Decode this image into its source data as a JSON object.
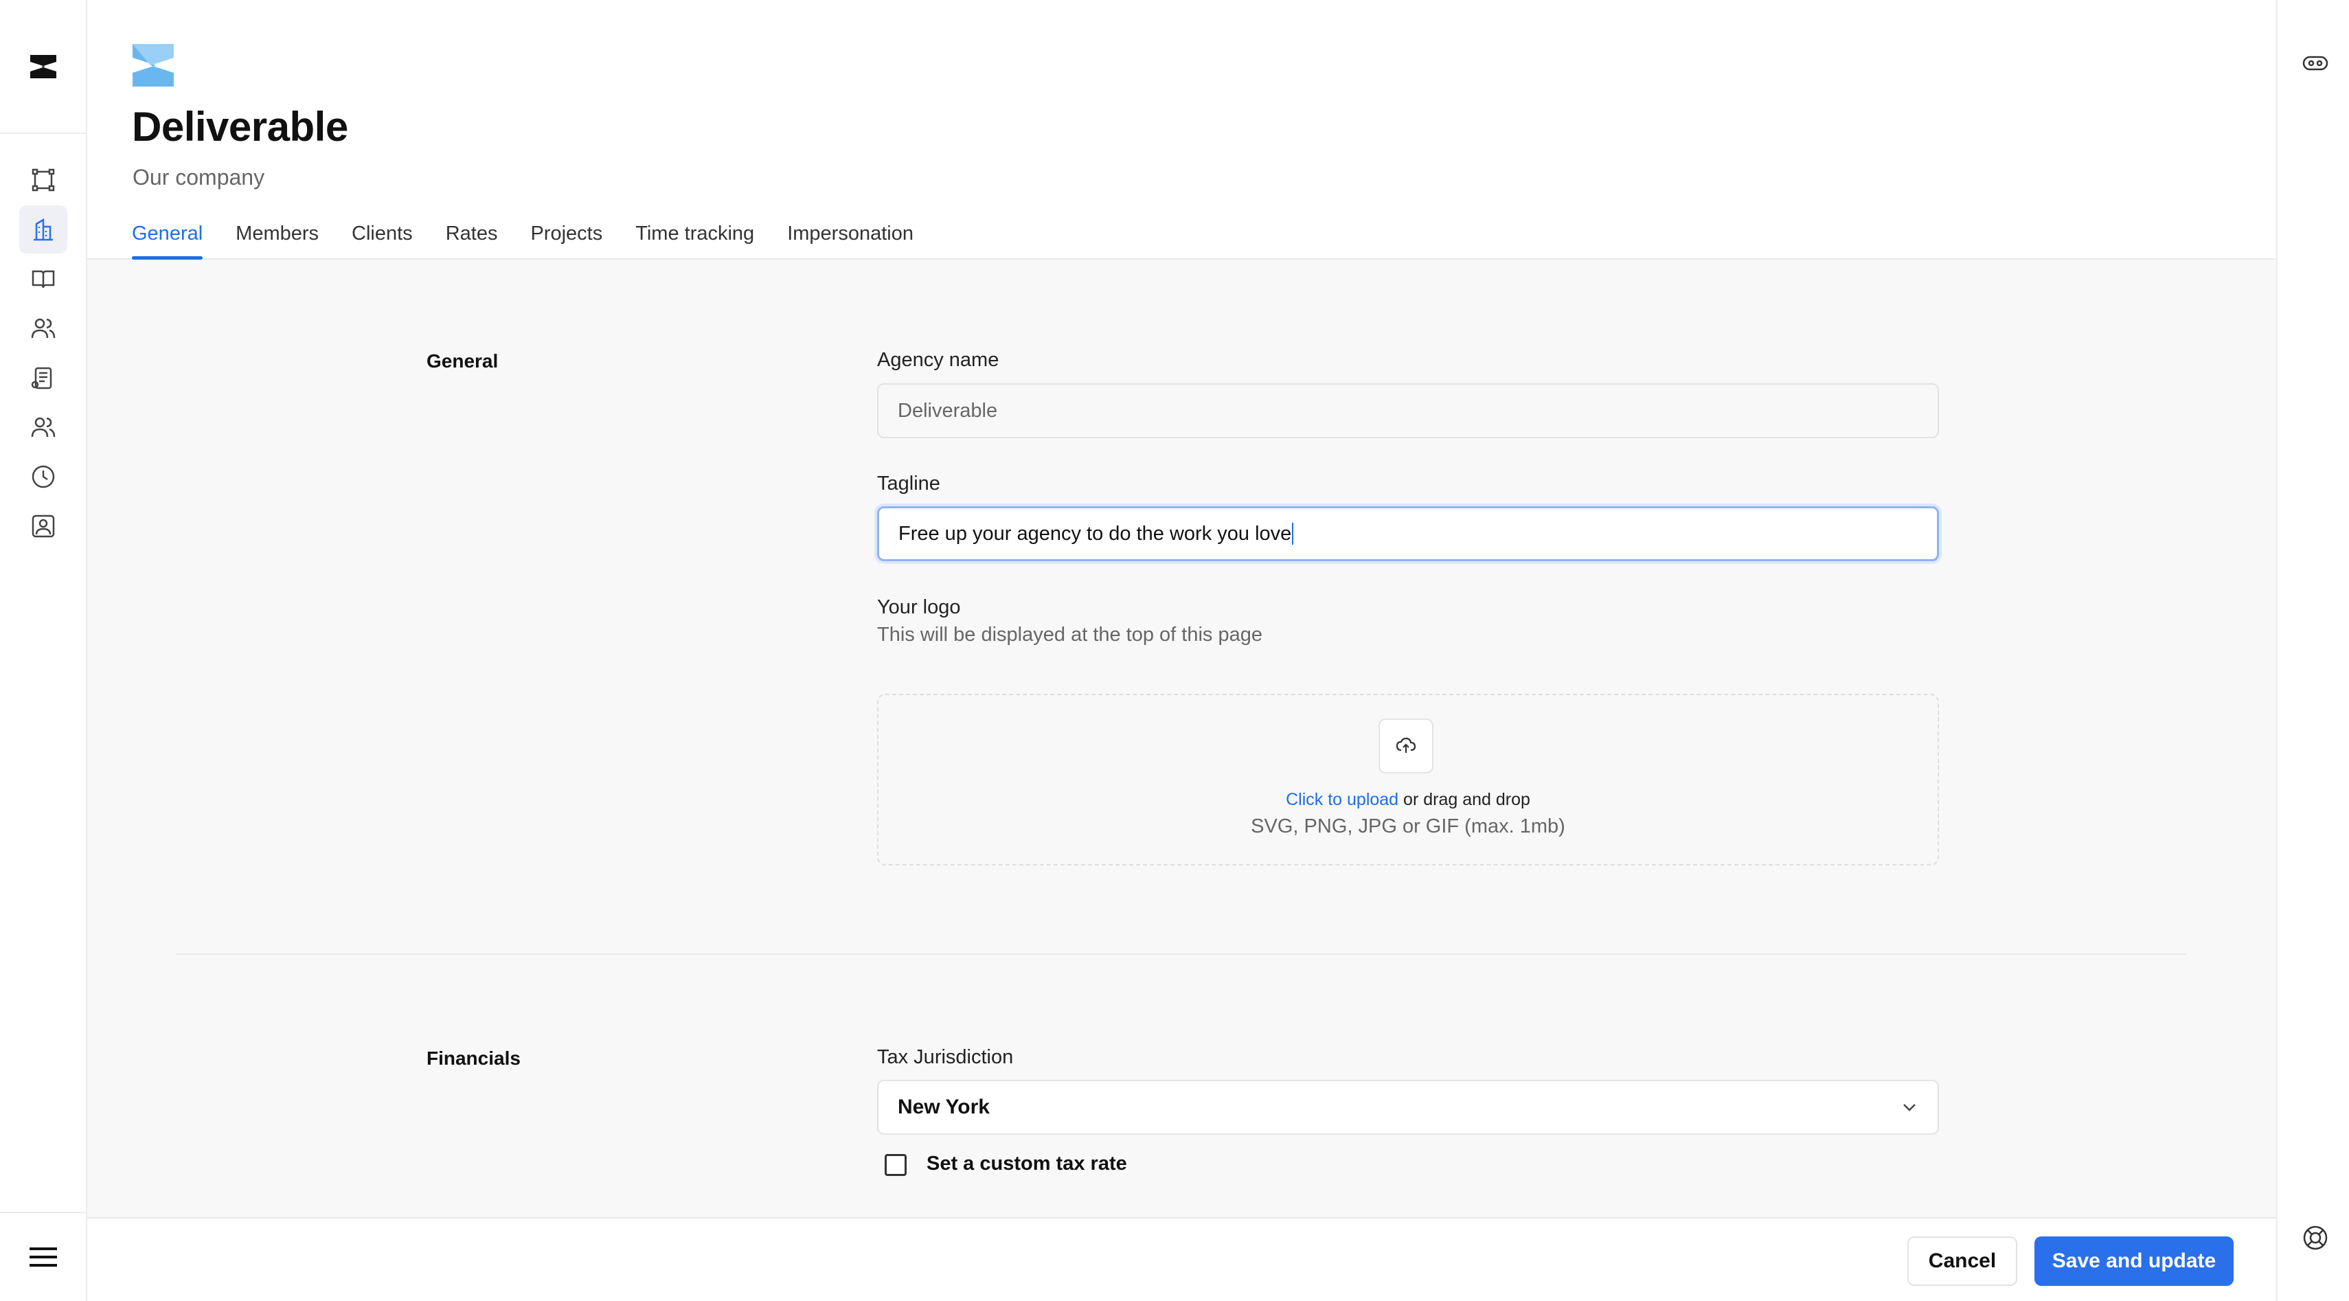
{
  "header": {
    "title": "Deliverable",
    "subtitle": "Our company"
  },
  "tabs": [
    {
      "label": "General",
      "active": true
    },
    {
      "label": "Members"
    },
    {
      "label": "Clients"
    },
    {
      "label": "Rates"
    },
    {
      "label": "Projects"
    },
    {
      "label": "Time tracking"
    },
    {
      "label": "Impersonation"
    }
  ],
  "sidebar": {
    "items": [
      {
        "icon": "workflow-icon"
      },
      {
        "icon": "building-icon",
        "active": true
      },
      {
        "icon": "book-icon"
      },
      {
        "icon": "users-icon"
      },
      {
        "icon": "clipboard-icon"
      },
      {
        "icon": "team-icon"
      },
      {
        "icon": "clock-icon"
      },
      {
        "icon": "contact-card-icon"
      }
    ]
  },
  "general": {
    "section_label": "General",
    "agency_name_label": "Agency name",
    "agency_name_value": "Deliverable",
    "tagline_label": "Tagline",
    "tagline_value": "Free up your agency to do the work you love",
    "logo_label": "Your logo",
    "logo_help": "This will be displayed at the top of this page",
    "upload_link": "Click to upload",
    "upload_rest": " or drag and drop",
    "upload_formats": "SVG, PNG, JPG or GIF (max. 1mb)"
  },
  "financials": {
    "section_label": "Financials",
    "tax_label": "Tax Jurisdiction",
    "tax_value": "New York",
    "custom_rate_label": "Set a custom tax rate",
    "custom_rate_checked": false
  },
  "footer": {
    "cancel_label": "Cancel",
    "save_label": "Save and update"
  },
  "colors": {
    "accent": "#1f6ee6",
    "primary_button": "#2a70ea",
    "logo_blue": "#6ab7f0"
  }
}
